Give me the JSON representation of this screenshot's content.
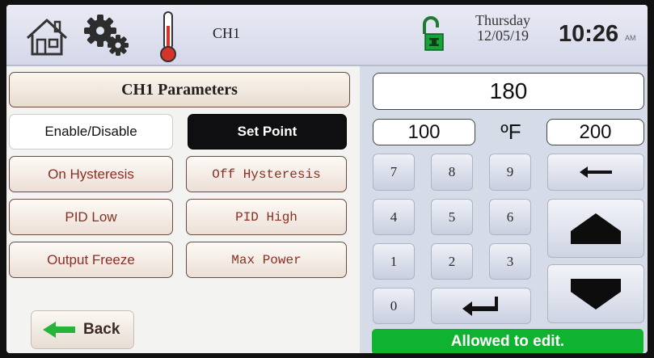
{
  "header": {
    "icons": [
      "home-icon",
      "gear-icon",
      "thermometer-icon",
      "lock-icon"
    ],
    "channel": "CH1",
    "day": "Thursday",
    "date": "12/05/19",
    "time": "10:26",
    "ampm": "AM"
  },
  "panel": {
    "title": "CH1 Parameters",
    "buttons": {
      "enable": "Enable/Disable",
      "setpoint": "Set Point",
      "on_hyst": "On Hysteresis",
      "off_hyst": "Off Hysteresis",
      "pid_low": "PID Low",
      "pid_high": "PID High",
      "output_freeze": "Output Freeze",
      "max_power": "Max Power"
    },
    "back": "Back"
  },
  "keypad": {
    "value": "180",
    "min": "100",
    "unit": "ºF",
    "max": "200",
    "keys": [
      "7",
      "8",
      "9",
      "4",
      "5",
      "6",
      "1",
      "2",
      "3",
      "0"
    ],
    "status": "Allowed to edit."
  },
  "colors": {
    "accent_green": "#0fb32f",
    "button_text": "#8a2f22",
    "selected_bg": "#0f0f12"
  }
}
